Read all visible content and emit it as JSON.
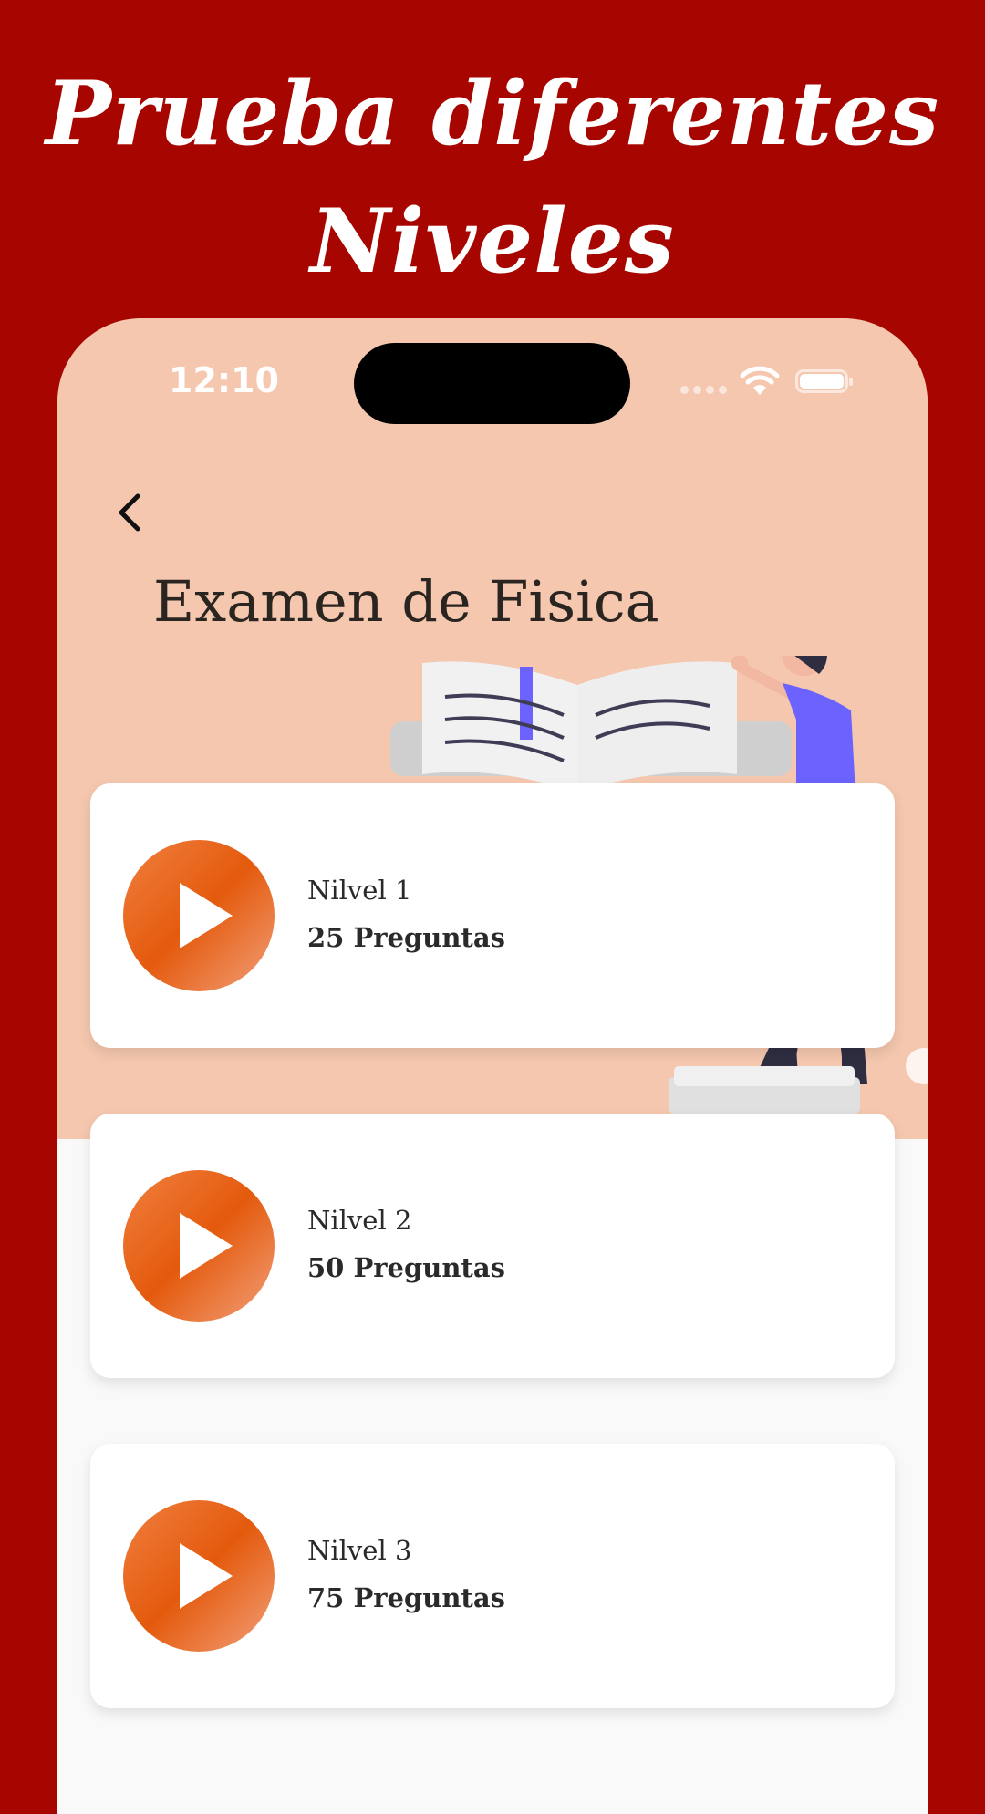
{
  "promo": {
    "title_line1": "Prueba diferentes",
    "title_line2": "Niveles"
  },
  "status_bar": {
    "time": "12:10"
  },
  "screen": {
    "title": "Examen de Fisica"
  },
  "levels": [
    {
      "name": "Nilvel 1",
      "questions": "25 Preguntas"
    },
    {
      "name": "Nilvel 2",
      "questions": "50 Preguntas"
    },
    {
      "name": "Nilvel 3",
      "questions": "75 Preguntas"
    }
  ],
  "colors": {
    "background": "#a70500",
    "hero": "#f4c7ae",
    "accent": "#e45a0d"
  }
}
